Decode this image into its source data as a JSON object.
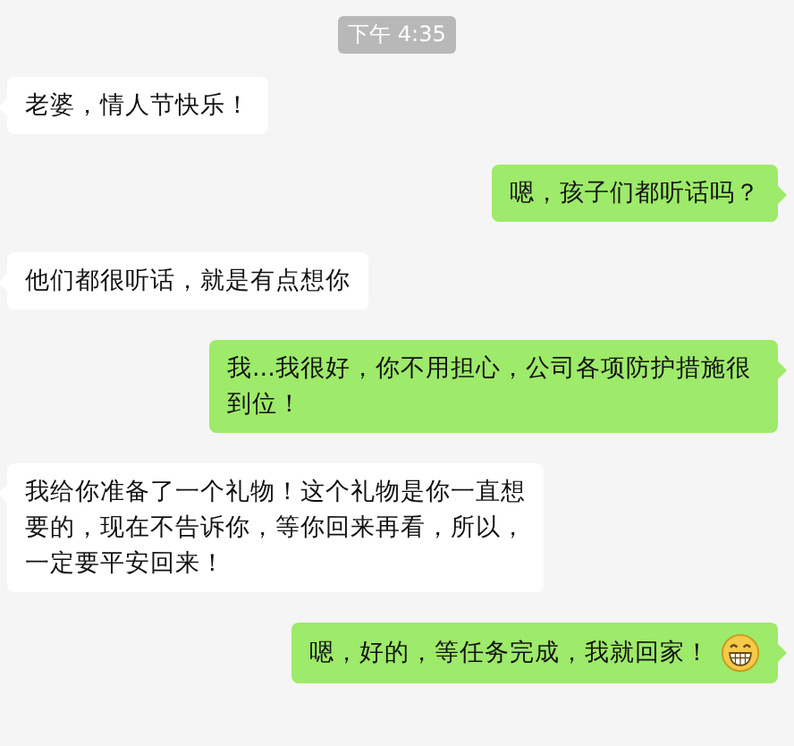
{
  "timestamp": "下午 4:35",
  "messages": [
    {
      "kind": "received",
      "text": "老婆，情人节快乐！"
    },
    {
      "kind": "sent",
      "text": "嗯，孩子们都听话吗？"
    },
    {
      "kind": "received",
      "text": "他们都很听话，就是有点想你"
    },
    {
      "kind": "sent",
      "text": "我...我很好，你不用担心，公司各项防护措施很到位！"
    },
    {
      "kind": "received",
      "text": "我给你准备了一个礼物！这个礼物是你一直想要的，现在不告诉你，等你回来再看，所以，一定要平安回来！"
    },
    {
      "kind": "sent",
      "text": "嗯，好的，等任务完成，我就回家！",
      "grin": true
    }
  ]
}
